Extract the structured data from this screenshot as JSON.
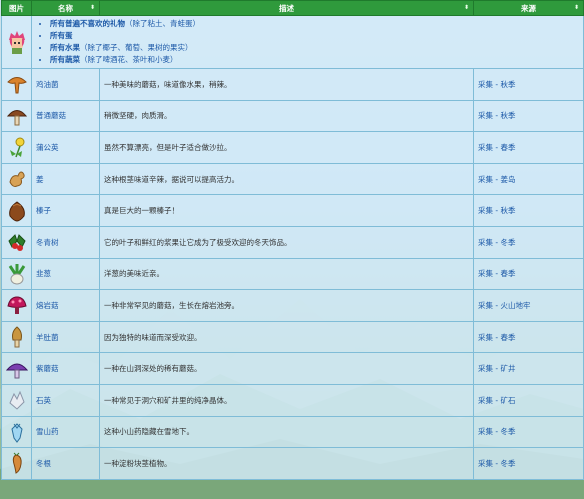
{
  "header": {
    "col_image": "图片",
    "col_name": "名称",
    "col_desc": "描述",
    "col_source": "来源",
    "sort_glyph": "⬍"
  },
  "universal": [
    {
      "label": "所有普遍不喜欢的礼物",
      "note": "（除了粘土、青蛙蛋）"
    },
    {
      "label": "所有蛋",
      "note": ""
    },
    {
      "label": "所有水果",
      "note": "（除了椰子、葡萄、果树的果实）"
    },
    {
      "label": "所有蔬菜",
      "note": "（除了啤酒花、茶叶和小麦）"
    }
  ],
  "items": [
    {
      "name": "鸡油菌",
      "desc": "一种美味的蘑菇，味道像水果，稍辣。",
      "source": "采集 - 秋季",
      "icon": "chanterelle-icon"
    },
    {
      "name": "普通蘑菇",
      "desc": "稍微坚硬，肉质滑。",
      "source": "采集 - 秋季",
      "icon": "common-mushroom-icon"
    },
    {
      "name": "蒲公英",
      "desc": "虽然不算漂亮，但是叶子适合做沙拉。",
      "source": "采集 - 春季",
      "icon": "dandelion-icon"
    },
    {
      "name": "姜",
      "desc": "这种根茎味道辛辣，据说可以提高活力。",
      "source": "采集 - 姜岛",
      "icon": "ginger-icon"
    },
    {
      "name": "榛子",
      "desc": "真是巨大的一颗榛子！",
      "source": "采集 - 秋季",
      "icon": "hazelnut-icon"
    },
    {
      "name": "冬青树",
      "desc": "它的叶子和鲜红的浆果让它成为了极受欢迎的冬天饰品。",
      "source": "采集 - 冬季",
      "icon": "holly-icon"
    },
    {
      "name": "韭葱",
      "desc": "洋葱的美味近亲。",
      "source": "采集 - 春季",
      "icon": "leek-icon"
    },
    {
      "name": "熔岩菇",
      "desc": "一种非常罕见的蘑菇，生长在熔岩池旁。",
      "source": "采集 - 火山地牢",
      "icon": "magma-cap-icon"
    },
    {
      "name": "羊肚菌",
      "desc": "因为独特的味道而深受欢迎。",
      "source": "采集 - 春季",
      "icon": "morel-icon"
    },
    {
      "name": "紫蘑菇",
      "desc": "一种在山洞深处的稀有蘑菇。",
      "source": "采集 - 矿井",
      "icon": "purple-mushroom-icon"
    },
    {
      "name": "石英",
      "desc": "一种常见于洞穴和矿井里的纯净晶体。",
      "source": "采集 - 矿石",
      "icon": "quartz-icon"
    },
    {
      "name": "雪山药",
      "desc": "这种小山药隐藏在雪地下。",
      "source": "采集 - 冬季",
      "icon": "snow-yam-icon"
    },
    {
      "name": "冬根",
      "desc": "一种淀粉块茎植物。",
      "source": "采集 - 冬季",
      "icon": "winter-root-icon"
    }
  ]
}
